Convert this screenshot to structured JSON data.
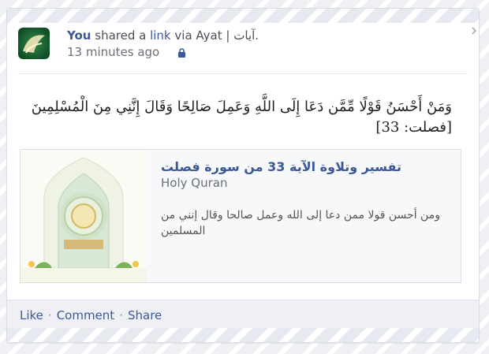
{
  "post": {
    "author": "You",
    "shared_text": "shared a",
    "link_label": "link",
    "via_text": "via Ayat | آيات.",
    "time": "13 minutes ago",
    "body": "وَمَنْ أَحْسَنُ قَوْلًا مِّمَّن دَعَا إِلَى اللَّهِ وَعَمِلَ صَالِحًا وَقَالَ إِنَّنِي مِنَ الْمُسْلِمِينَ [فصلت: 33]"
  },
  "share": {
    "title": "تفسير وتلاوة الآية 33 من سورة فصلت",
    "site": "Holy Quran",
    "description": "ومن أحسن قولا ممن دعا إلى الله وعمل صالحا وقال إنني من المسلمين"
  },
  "actions": {
    "like": "Like",
    "comment": "Comment",
    "share": "Share",
    "sep": "·"
  },
  "colors": {
    "brand": "#3b5998",
    "avatar_green": "#1e6b3a"
  },
  "icons": [
    "lock-icon",
    "chevron-icon",
    "quran-app-logo",
    "quran-book-image"
  ]
}
